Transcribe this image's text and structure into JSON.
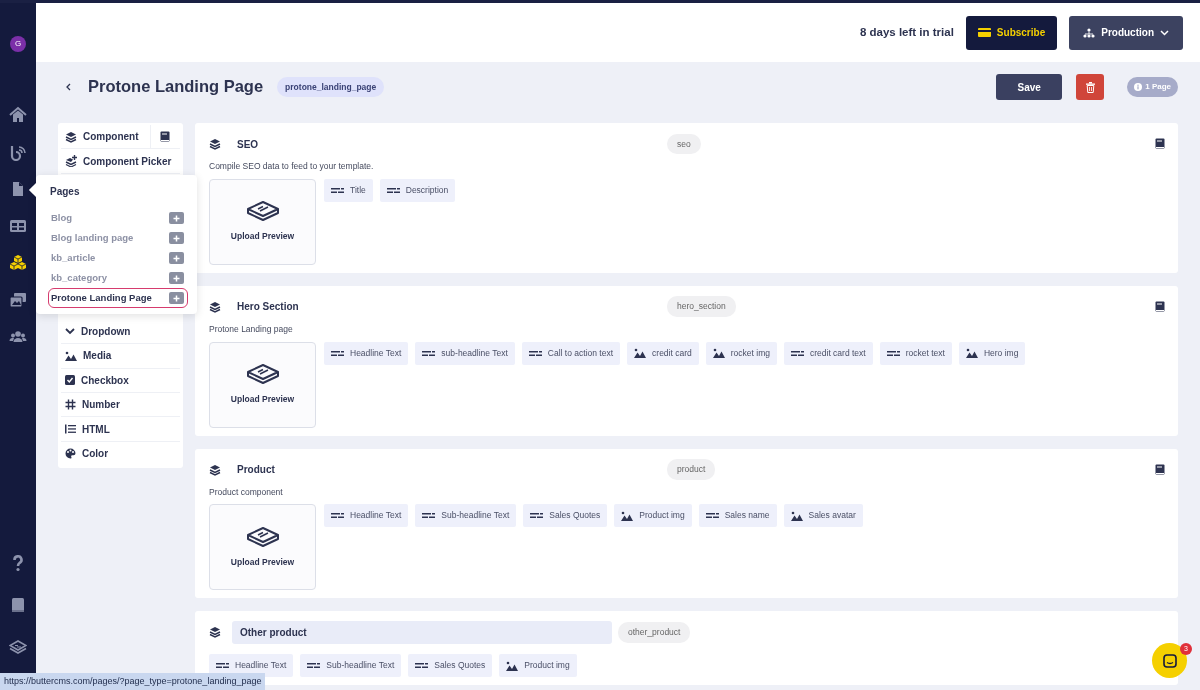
{
  "avatar": {
    "letter": "G"
  },
  "nav_top": [
    {
      "kind": "home",
      "selected": false
    },
    {
      "kind": "blog",
      "selected": false
    },
    {
      "kind": "pages",
      "selected": false
    },
    {
      "kind": "collections",
      "selected": false
    },
    {
      "kind": "components",
      "selected": true
    },
    {
      "kind": "media",
      "selected": false
    },
    {
      "kind": "users",
      "selected": false
    }
  ],
  "nav_bottom": [
    {
      "kind": "help",
      "selected": false
    },
    {
      "kind": "docs",
      "selected": false
    },
    {
      "kind": "layers",
      "selected": false
    }
  ],
  "top_bar": {
    "trial_text": "8 days left in trial",
    "subscribe_button": "Subscribe",
    "environment_button": "Production"
  },
  "page": {
    "title": "Protone Landing Page",
    "slug": "protone_landing_page",
    "save_button": "Save",
    "page_count": "1 Page"
  },
  "component_panel": {
    "top_items": [
      {
        "kind": "component",
        "label": "Component"
      },
      {
        "kind": "picker",
        "label": "Component Picker"
      }
    ],
    "items": [
      {
        "kind": "dropdown",
        "label": "Dropdown"
      },
      {
        "kind": "media",
        "label": "Media"
      },
      {
        "kind": "checkbox",
        "label": "Checkbox"
      },
      {
        "kind": "number",
        "label": "Number"
      },
      {
        "kind": "html",
        "label": "HTML"
      },
      {
        "kind": "color",
        "label": "Color"
      }
    ]
  },
  "pages_popover": {
    "title": "Pages",
    "items": [
      {
        "label": "Blog",
        "selected": false
      },
      {
        "label": "Blog landing page",
        "selected": false
      },
      {
        "label": "kb_article",
        "selected": false
      },
      {
        "label": "kb_category",
        "selected": false
      },
      {
        "label": "Protone Landing Page",
        "selected": true
      }
    ]
  },
  "cards": [
    {
      "title": "SEO",
      "slug": "seo",
      "editing": false,
      "docs_icon": true,
      "description": "Compile SEO data to feed to your template.",
      "preview_label": "Upload Preview",
      "fields": [
        {
          "kind": "text",
          "label": "Title"
        },
        {
          "kind": "text",
          "label": "Description"
        }
      ]
    },
    {
      "title": "Hero Section",
      "slug": "hero_section",
      "editing": false,
      "docs_icon": true,
      "description": "Protone Landing page",
      "preview_label": "Upload Preview",
      "fields": [
        {
          "kind": "text",
          "label": "Headline Text"
        },
        {
          "kind": "text",
          "label": "sub-headline Text"
        },
        {
          "kind": "text",
          "label": "Call to action text"
        },
        {
          "kind": "media",
          "label": "credit card"
        },
        {
          "kind": "media",
          "label": "rocket img"
        },
        {
          "kind": "text",
          "label": "credit card text"
        },
        {
          "kind": "text",
          "label": "rocket text"
        },
        {
          "kind": "media",
          "label": "Hero img"
        }
      ]
    },
    {
      "title": "Product",
      "slug": "product",
      "editing": false,
      "docs_icon": true,
      "description": "Product component",
      "preview_label": "Upload Preview",
      "fields": [
        {
          "kind": "text",
          "label": "Headline Text"
        },
        {
          "kind": "text",
          "label": "Sub-headline Text"
        },
        {
          "kind": "text",
          "label": "Sales Quotes"
        },
        {
          "kind": "media",
          "label": "Product img"
        },
        {
          "kind": "text",
          "label": "Sales name"
        },
        {
          "kind": "media",
          "label": "Sales avatar"
        }
      ]
    },
    {
      "title": "Other product",
      "slug": "other_product",
      "editing": true,
      "docs_icon": false,
      "fields": [
        {
          "kind": "text",
          "label": "Headline Text"
        },
        {
          "kind": "text",
          "label": "Sub-headline Text"
        },
        {
          "kind": "text",
          "label": "Sales Quotes"
        },
        {
          "kind": "media",
          "label": "Product img"
        }
      ]
    }
  ],
  "status_url": "https://buttercms.com/pages/?page_type=protone_landing_page",
  "chat": {
    "badge": "3"
  }
}
